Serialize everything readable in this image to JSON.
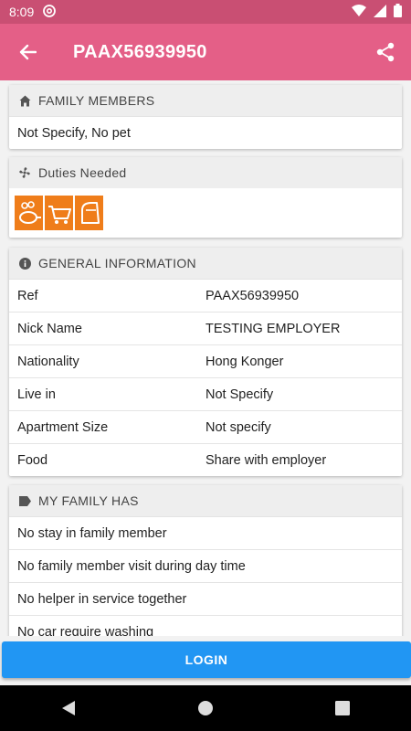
{
  "status": {
    "time": "8:09"
  },
  "appbar": {
    "title": "PAAX56939950"
  },
  "family_members": {
    "header": "FAMILY MEMBERS",
    "value": "Not Specify, No pet"
  },
  "duties": {
    "header": "Duties Needed",
    "icons": [
      "cooking-icon",
      "shopping-cart-icon",
      "ironing-icon"
    ]
  },
  "general": {
    "header": "GENERAL INFORMATION",
    "rows": [
      {
        "label": "Ref",
        "value": "PAAX56939950"
      },
      {
        "label": "Nick Name",
        "value": "TESTING EMPLOYER"
      },
      {
        "label": "Nationality",
        "value": "Hong Konger"
      },
      {
        "label": "Live in",
        "value": "Not Specify"
      },
      {
        "label": "Apartment Size",
        "value": "Not specify"
      },
      {
        "label": "Food",
        "value": "Share with employer"
      }
    ]
  },
  "family_has": {
    "header": "MY FAMILY HAS",
    "items": [
      "No stay in family member",
      "No family member visit during day time",
      "No helper in service together",
      "No car require washing"
    ]
  },
  "login_label": "LOGIN",
  "colors": {
    "appbar": "#e45f87",
    "statusbar": "#c94f73",
    "accent": "#2196f3",
    "duty": "#ef7d1a"
  }
}
